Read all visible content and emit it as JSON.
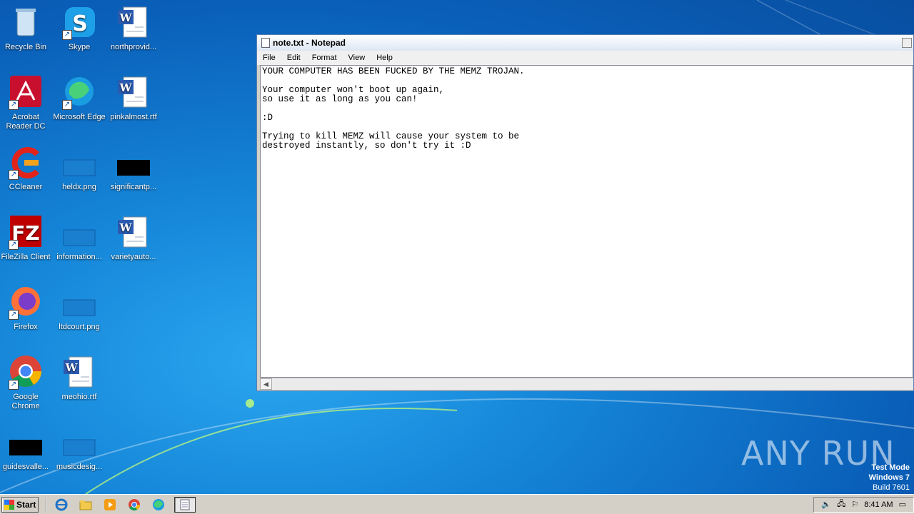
{
  "desktop": {
    "icons": [
      {
        "label": "Recycle Bin",
        "icon": "recycle-bin-icon"
      },
      {
        "label": "Skype",
        "icon": "skype-icon"
      },
      {
        "label": "northprovid...",
        "icon": "word-doc-icon"
      },
      {
        "label": "Acrobat Reader DC",
        "icon": "acrobat-icon"
      },
      {
        "label": "Microsoft Edge",
        "icon": "edge-icon"
      },
      {
        "label": "pinkalmost.rtf",
        "icon": "word-doc-icon"
      },
      {
        "label": "CCleaner",
        "icon": "ccleaner-icon"
      },
      {
        "label": "heldx.png",
        "icon": "image-file-icon"
      },
      {
        "label": "significantp...",
        "icon": "black-file-icon"
      },
      {
        "label": "FileZilla Client",
        "icon": "filezilla-icon"
      },
      {
        "label": "information...",
        "icon": "image-file-icon"
      },
      {
        "label": "varietyauto...",
        "icon": "word-doc-icon"
      },
      {
        "label": "Firefox",
        "icon": "firefox-icon"
      },
      {
        "label": "ltdcourt.png",
        "icon": "image-file-icon"
      },
      {
        "label": "Google Chrome",
        "icon": "chrome-icon"
      },
      {
        "label": "meohio.rtf",
        "icon": "word-doc-icon"
      },
      {
        "label": "guidesvalle...",
        "icon": "black-file-icon"
      },
      {
        "label": "musicdesig...",
        "icon": "image-file-icon"
      }
    ]
  },
  "notepad": {
    "title": "note.txt - Notepad",
    "menu": [
      "File",
      "Edit",
      "Format",
      "View",
      "Help"
    ],
    "content": "YOUR COMPUTER HAS BEEN FUCKED BY THE MEMZ TROJAN.\n\nYour computer won't boot up again,\nso use it as long as you can!\n\n:D\n\nTrying to kill MEMZ will cause your system to be\ndestroyed instantly, so don't try it :D"
  },
  "watermark": {
    "text": "ANY  RUN",
    "test_mode": "Test Mode",
    "os": "Windows 7",
    "build": "Build 7601"
  },
  "taskbar": {
    "start_label": "Start",
    "clock": "8:41 AM"
  },
  "colors": {
    "desktop_blue": "#1483d6",
    "taskbar": "#d4d0c8"
  }
}
